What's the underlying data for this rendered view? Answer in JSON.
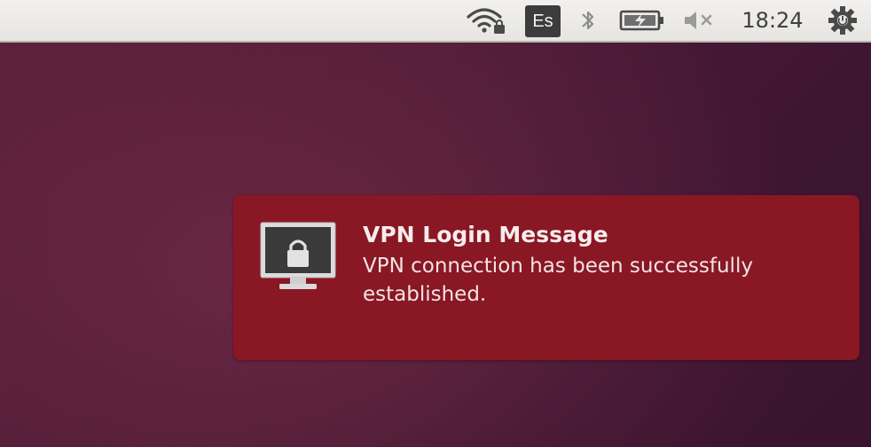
{
  "panel": {
    "language": "Es",
    "clock": "18:24",
    "icons": {
      "wifi": "wifi-lock-icon",
      "bluetooth": "bluetooth-icon",
      "battery": "battery-charging-icon",
      "volume": "volume-muted-icon",
      "session": "gear-power-icon"
    }
  },
  "notification": {
    "title": "VPN Login Message",
    "body": "VPN connection has been successfully established.",
    "icon": "vpn-lock-monitor-icon",
    "background_color": "#8a1724"
  }
}
